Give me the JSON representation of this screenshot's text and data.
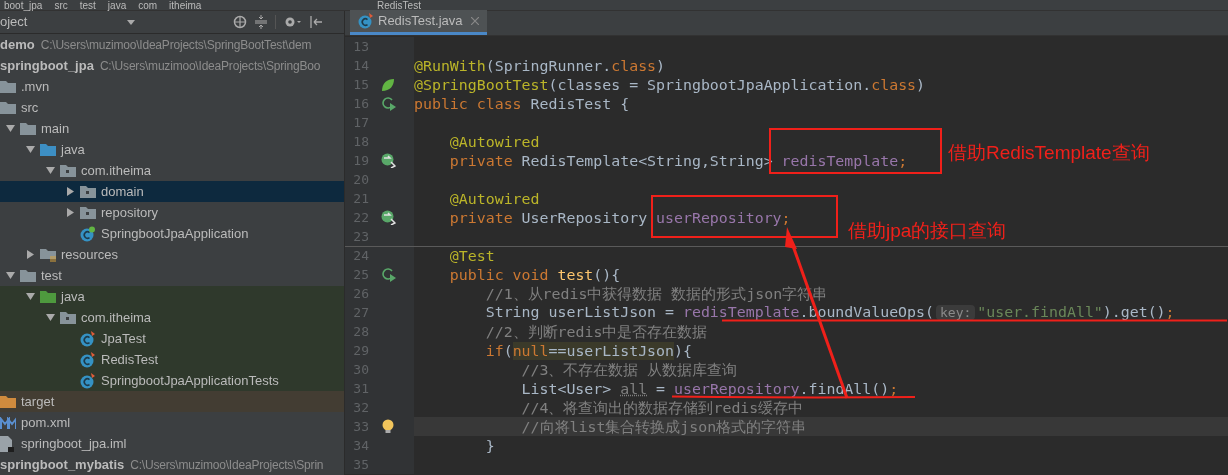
{
  "breadcrumb": [
    "boot_jpa",
    "src",
    "test",
    "java",
    "com",
    "itheima"
  ],
  "breadcrumb_right": "RedisTest",
  "project_panel": {
    "title": "oject"
  },
  "tree": [
    {
      "label": "demo",
      "path": "C:\\Users\\muzimoo\\IdeaProjects\\SpringBootTest\\dem",
      "kind": "module",
      "selected": false
    },
    {
      "label": "springboot_jpa",
      "path": "C:\\Users\\muzimoo\\IdeaProjects\\SpringBoo",
      "kind": "module",
      "selected": false,
      "children": [
        {
          "label": ".mvn",
          "kind": "folder",
          "selected": false
        },
        {
          "label": "src",
          "kind": "folder",
          "selected": false,
          "children": [
            {
              "label": "main",
              "kind": "folder",
              "expanded": true,
              "selected": false,
              "children": [
                {
                  "label": "java",
                  "kind": "source_folder",
                  "expanded": true,
                  "selected": false,
                  "children": [
                    {
                      "label": "com.itheima",
                      "kind": "package",
                      "expanded": true,
                      "selected": false,
                      "children": [
                        {
                          "label": "domain",
                          "kind": "package",
                          "expanded": false,
                          "selected": true
                        },
                        {
                          "label": "repository",
                          "kind": "package",
                          "expanded": false,
                          "selected": false
                        },
                        {
                          "label": "SpringbootJpaApplication",
                          "kind": "spring_class",
                          "selected": false
                        }
                      ]
                    }
                  ]
                },
                {
                  "label": "resources",
                  "kind": "resources",
                  "expanded": false,
                  "selected": false
                }
              ]
            },
            {
              "label": "test",
              "kind": "folder",
              "expanded": true,
              "selected": false,
              "children": [
                {
                  "label": "java",
                  "kind": "test_folder",
                  "expanded": true,
                  "selected": false,
                  "children": [
                    {
                      "label": "com.itheima",
                      "kind": "package",
                      "expanded": true,
                      "selected": false,
                      "children": [
                        {
                          "label": "JpaTest",
                          "kind": "test_class",
                          "selected": false
                        },
                        {
                          "label": "RedisTest",
                          "kind": "test_class",
                          "selected": false
                        },
                        {
                          "label": "SpringbootJpaApplicationTests",
                          "kind": "test_class",
                          "selected": false
                        }
                      ]
                    }
                  ]
                }
              ]
            }
          ]
        },
        {
          "label": "target",
          "kind": "excluded",
          "selected": false
        },
        {
          "label": "pom.xml",
          "kind": "maven",
          "selected": false
        },
        {
          "label": "springboot_jpa.iml",
          "kind": "iml",
          "selected": false
        }
      ]
    },
    {
      "label": "springboot_mybatis",
      "path": "C:\\Users\\muzimoo\\IdeaProjects\\Sprin",
      "kind": "module",
      "selected": false
    }
  ],
  "editor_tabs": [
    {
      "label": "RedisTest.java",
      "selected": true
    }
  ],
  "code_lines": [
    {
      "n": "13"
    },
    {
      "n": "14",
      "t": [
        {
          "kind": "ann",
          "s": "@RunWith"
        },
        {
          "kind": "plain",
          "s": "(SpringRunner."
        },
        {
          "kind": "kw",
          "s": "class"
        },
        {
          "kind": "plain",
          "s": ")"
        }
      ]
    },
    {
      "n": "15",
      "gutter": {
        "kind": "leaf"
      },
      "t": [
        {
          "kind": "ann",
          "s": "@SpringBootTest"
        },
        {
          "kind": "plain",
          "s": "(classes = SpringbootJpaApplication."
        },
        {
          "kind": "kw",
          "s": "class"
        },
        {
          "kind": "plain",
          "s": ")"
        }
      ]
    },
    {
      "n": "16",
      "gutter": {
        "kind": "run"
      },
      "t": [
        {
          "kind": "kw",
          "s": "public class "
        },
        {
          "kind": "plain",
          "s": "RedisTest {"
        }
      ]
    },
    {
      "n": "17"
    },
    {
      "n": "18",
      "t": [
        {
          "kind": "ann",
          "s": "    @Autowired"
        }
      ]
    },
    {
      "n": "19",
      "gutter": {
        "kind": "bean"
      },
      "t": [
        {
          "kind": "kw",
          "s": "    private "
        },
        {
          "kind": "plain",
          "s": "RedisTemplate<String,String> "
        },
        {
          "kind": "field",
          "s": "redisTemplate"
        },
        {
          "kind": "kw",
          "s": ";"
        }
      ]
    },
    {
      "n": "20"
    },
    {
      "n": "21",
      "t": [
        {
          "kind": "ann",
          "s": "    @Autowired"
        }
      ]
    },
    {
      "n": "22",
      "gutter": {
        "kind": "bean"
      },
      "t": [
        {
          "kind": "kw",
          "s": "    private "
        },
        {
          "kind": "plain",
          "s": "UserRepository "
        },
        {
          "kind": "field",
          "s": "userRepository"
        },
        {
          "kind": "kw",
          "s": ";"
        }
      ]
    },
    {
      "n": "23"
    },
    {
      "n": "24",
      "separator": true,
      "t": [
        {
          "kind": "ann",
          "s": "    @Test"
        }
      ]
    },
    {
      "n": "25",
      "gutter": {
        "kind": "run"
      },
      "t": [
        {
          "kind": "kw",
          "s": "    public void "
        },
        {
          "kind": "method",
          "s": "test"
        },
        {
          "kind": "plain",
          "s": "(){"
        }
      ]
    },
    {
      "n": "26",
      "t": [
        {
          "kind": "comment",
          "s": "        //1、从redis中获得数据 数据的形式json字符串"
        }
      ]
    },
    {
      "n": "27",
      "t": [
        {
          "kind": "plain",
          "s": "        String userListJson = "
        },
        {
          "kind": "field",
          "s": "redisTemplate"
        },
        {
          "kind": "plain",
          "s": ".boundValueOps("
        },
        {
          "kind": "hint",
          "s": "key:"
        },
        {
          "kind": "string",
          "s": "\"user.findAll\""
        },
        {
          "kind": "plain",
          "s": ").get()"
        },
        {
          "kind": "kw",
          "s": ";"
        }
      ]
    },
    {
      "n": "28",
      "t": [
        {
          "kind": "comment",
          "s": "        //2、判断redis中是否存在数据"
        }
      ]
    },
    {
      "n": "29",
      "t": [
        {
          "kind": "kw",
          "s": "        if"
        },
        {
          "kind": "plain",
          "s": "("
        },
        {
          "kind": "kw_match",
          "s": "null"
        },
        {
          "kind": "match",
          "s": "==userListJson"
        },
        {
          "kind": "plain",
          "s": "){"
        }
      ]
    },
    {
      "n": "30",
      "t": [
        {
          "kind": "comment",
          "s": "            //3、不存在数据 从数据库查询"
        }
      ]
    },
    {
      "n": "31",
      "t": [
        {
          "kind": "plain",
          "s": "            List<User> "
        },
        {
          "kind": "unused",
          "s": "all"
        },
        {
          "kind": "plain",
          "s": " = "
        },
        {
          "kind": "field",
          "s": "userRepository"
        },
        {
          "kind": "plain",
          "s": ".findAll()"
        },
        {
          "kind": "kw",
          "s": ";"
        }
      ]
    },
    {
      "n": "32",
      "t": [
        {
          "kind": "comment",
          "s": "            //4、将查询出的数据存储到redis缓存中"
        }
      ]
    },
    {
      "n": "33",
      "gutter": {
        "kind": "bulb"
      },
      "current": true,
      "t": [
        {
          "kind": "comment",
          "s": "            //向将list集合转换成json格式的字符串"
        }
      ]
    },
    {
      "n": "34",
      "t": [
        {
          "kind": "plain",
          "s": "        }"
        }
      ]
    },
    {
      "n": "35"
    }
  ],
  "annotations": [
    {
      "kind": "box_label",
      "label": "借助RedisTemplate查询"
    },
    {
      "kind": "box_label",
      "label": "借助jpa的接口查询"
    },
    {
      "kind": "arrow"
    },
    {
      "kind": "underline"
    },
    {
      "kind": "underline"
    }
  ]
}
